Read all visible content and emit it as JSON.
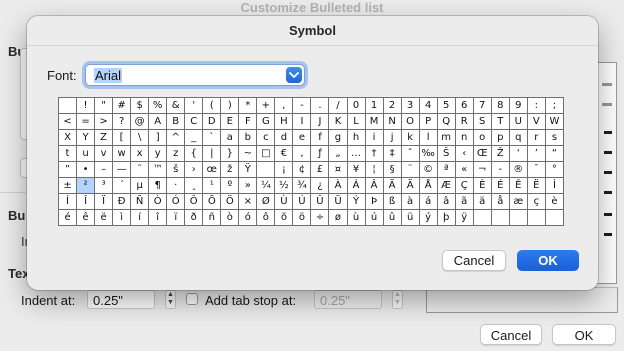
{
  "background": {
    "title": "Customize Bulleted list",
    "fragments": [
      "Bu",
      "Bu",
      "In",
      "Tex"
    ],
    "indent_label": "Indent at:",
    "indent_value": "0.25\"",
    "add_tab_label": "Add tab stop at:",
    "tab_value": "0.25\"",
    "cancel_label": "Cancel",
    "ok_label": "OK"
  },
  "symbol_dialog": {
    "title": "Symbol",
    "font_label": "Font:",
    "font_value": "Arial",
    "selected_cell": {
      "row": 5,
      "col": 1
    },
    "grid_rows": [
      [
        " ",
        "!",
        "\"",
        "#",
        "$",
        "%",
        "&",
        "'",
        "(",
        ")",
        "*",
        "+",
        ",",
        "-",
        ".",
        "/",
        "0",
        "1",
        "2",
        "3",
        "4",
        "5",
        "6",
        "7",
        "8",
        "9",
        ":",
        ";"
      ],
      [
        "<",
        "=",
        ">",
        "?",
        "@",
        "A",
        "B",
        "C",
        "D",
        "E",
        "F",
        "G",
        "H",
        "I",
        "J",
        "K",
        "L",
        "M",
        "N",
        "O",
        "P",
        "Q",
        "R",
        "S",
        "T",
        "U",
        "V",
        "W"
      ],
      [
        "X",
        "Y",
        "Z",
        "[",
        "\\",
        "]",
        "^",
        "_",
        "`",
        "a",
        "b",
        "c",
        "d",
        "e",
        "f",
        "g",
        "h",
        "i",
        "j",
        "k",
        "l",
        "m",
        "n",
        "o",
        "p",
        "q",
        "r",
        "s"
      ],
      [
        "t",
        "u",
        "v",
        "w",
        "x",
        "y",
        "z",
        "{",
        "|",
        "}",
        "~",
        "□",
        "€",
        ",",
        "ƒ",
        "„",
        "…",
        "†",
        "‡",
        "ˆ",
        "‰",
        "Š",
        "‹",
        "Œ",
        "Ž",
        "‘",
        "’",
        "“"
      ],
      [
        "”",
        "•",
        "–",
        "—",
        "˜",
        "™",
        "š",
        "›",
        "œ",
        "ž",
        "Ÿ",
        " ",
        "¡",
        "¢",
        "£",
        "¤",
        "¥",
        "¦",
        "§",
        "¨",
        "©",
        "ª",
        "«",
        "¬",
        "-",
        "®",
        "¯",
        "°"
      ],
      [
        "±",
        "²",
        "³",
        "´",
        "µ",
        "¶",
        "·",
        "¸",
        "¹",
        "º",
        "»",
        "¼",
        "½",
        "¾",
        "¿",
        "À",
        "Á",
        "Â",
        "Ã",
        "Ä",
        "Å",
        "Æ",
        "Ç",
        "È",
        "É",
        "Ê",
        "Ë",
        "Ì"
      ],
      [
        "Í",
        "Î",
        "Ï",
        "Ð",
        "Ñ",
        "Ò",
        "Ó",
        "Ô",
        "Õ",
        "Ö",
        "×",
        "Ø",
        "Ù",
        "Ú",
        "Û",
        "Ü",
        "Ý",
        "Þ",
        "ß",
        "à",
        "á",
        "â",
        "ã",
        "ä",
        "å",
        "æ",
        "ç",
        "è"
      ],
      [
        "é",
        "ê",
        "ë",
        "ì",
        "í",
        "î",
        "ï",
        "ð",
        "ñ",
        "ò",
        "ó",
        "ô",
        "õ",
        "ö",
        "÷",
        "ø",
        "ù",
        "ú",
        "û",
        "ü",
        "ý",
        "þ",
        "ÿ",
        "",
        "",
        "",
        "",
        ""
      ]
    ],
    "cancel_label": "Cancel",
    "ok_label": "OK"
  },
  "colors": {
    "accent": "#1f67d8",
    "selection": "#b5d3fb"
  },
  "icons": {
    "font_dropdown": "chevron-down-icon",
    "stepper": "stepper-arrows-icon"
  }
}
